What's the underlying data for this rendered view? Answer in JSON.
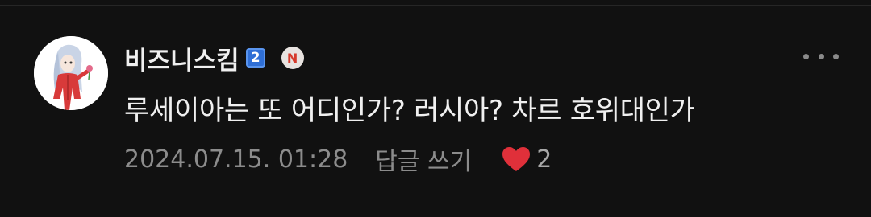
{
  "comment": {
    "username": "비즈니스킴",
    "level_badge": "2",
    "new_badge": "N",
    "text": "루세이아는 또 어디인가? 러시아? 차르 호위대인가",
    "timestamp": "2024.07.15. 01:28",
    "reply_label": "답글 쓰기",
    "like_count": "2",
    "more_icon": "more-horizontal-icon",
    "like_icon": "heart-icon"
  },
  "colors": {
    "background": "#111111",
    "text_primary": "#f0f0f0",
    "text_secondary": "#8c8c8c",
    "level_badge": "#2f6fd6",
    "new_badge_text": "#d63a2c",
    "heart": "#e0303a"
  }
}
